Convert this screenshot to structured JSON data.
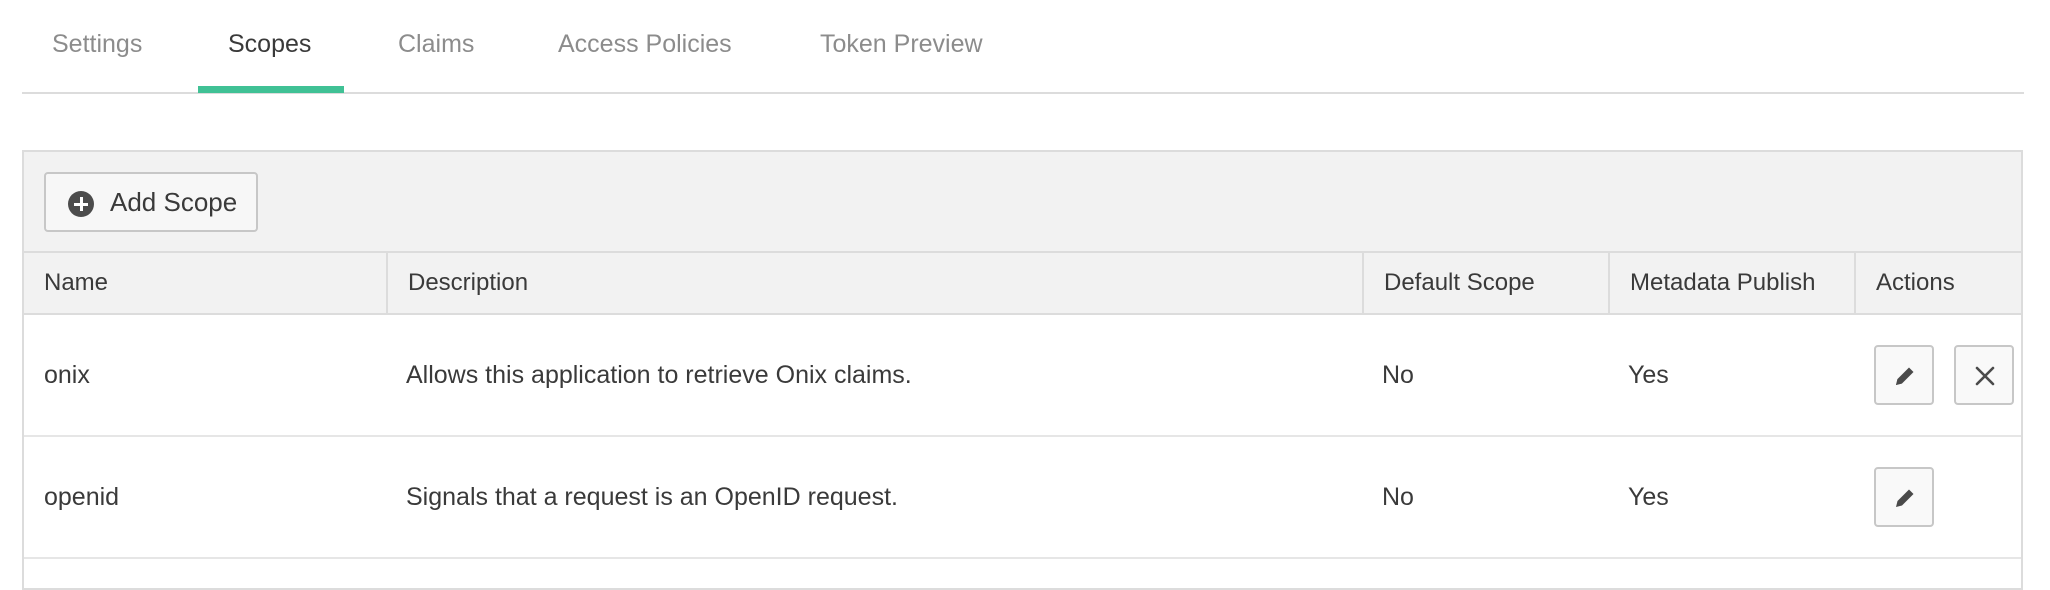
{
  "tabs": [
    {
      "label": "Settings",
      "active": false
    },
    {
      "label": "Scopes",
      "active": true
    },
    {
      "label": "Claims",
      "active": false
    },
    {
      "label": "Access Policies",
      "active": false
    },
    {
      "label": "Token Preview",
      "active": false
    }
  ],
  "toolbar": {
    "add_label": "Add Scope",
    "add_icon": "plus-circle-icon"
  },
  "table": {
    "columns": [
      "Name",
      "Description",
      "Default Scope",
      "Metadata Publish",
      "Actions"
    ],
    "rows": [
      {
        "name": "onix",
        "description": "Allows this application to retrieve Onix claims.",
        "default_scope": "No",
        "metadata_publish": "Yes",
        "actions": [
          "pencil-icon",
          "close-icon"
        ]
      },
      {
        "name": "openid",
        "description": "Signals that a request is an OpenID request.",
        "default_scope": "No",
        "metadata_publish": "Yes",
        "actions": [
          "pencil-icon"
        ]
      }
    ]
  },
  "colors": {
    "accent": "#40c195",
    "header_bg": "#f2f2f2",
    "border": "#dcdcdc",
    "text": "#3a3a3a",
    "muted_text": "#8c8c8c"
  }
}
